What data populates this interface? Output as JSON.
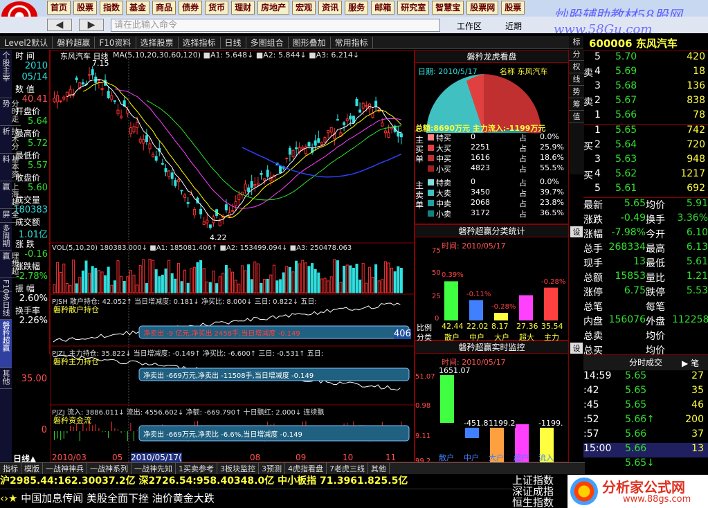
{
  "menu": [
    "首页",
    "股票",
    "指数",
    "基金",
    "商品",
    "债券",
    "货币",
    "理财",
    "房地产",
    "宏观",
    "资讯",
    "服务",
    "邮箱",
    "研究室",
    "智慧宝",
    "股票网",
    "股票"
  ],
  "watermark": "炒股辅助教材58股网",
  "watermark_url": "www.58Gu.com",
  "cmd_placeholder": "请在此输入命令",
  "bar2_right": [
    "工作区",
    "近期",
    "常用指标"
  ],
  "toolbar": [
    "Level2默认",
    "磐矜超赢",
    "F10资料",
    "选择股票",
    "选择指标",
    "日线",
    "多图组合",
    "图形叠加",
    "常用指标"
  ],
  "left_tabs": [
    "个股主宰",
    "分时走势",
    "技术分析",
    "基本资料",
    "上海超赢",
    "全屏",
    "多周期",
    "理想超赢",
    "F10",
    "多日线",
    "磐矜超赢",
    "其他"
  ],
  "info": [
    {
      "label": "时 间",
      "value": "2010",
      "value2": "05/14",
      "c": "cyan"
    },
    {
      "label": "数 值",
      "value": "40.41",
      "c": "red"
    },
    {
      "label": "开盘价",
      "value": "5.64",
      "c": "green"
    },
    {
      "label": "最高价",
      "value": "5.72",
      "c": "green"
    },
    {
      "label": "最低价",
      "value": "5.57",
      "c": "green"
    },
    {
      "label": "收盘价",
      "value": "5.60",
      "c": "green"
    },
    {
      "label": "成交量",
      "value": "180383",
      "c": "cyan"
    },
    {
      "label": "成交额",
      "value": "1.01亿",
      "c": "cyan"
    },
    {
      "label": "涨 跌",
      "value": "-0.16",
      "c": "green"
    },
    {
      "label": "涨跌幅",
      "value": "-2.78%",
      "c": "green"
    },
    {
      "label": "振 幅",
      "value": "2.60%",
      "c": "white"
    },
    {
      "label": "换手率",
      "value": "2.26%",
      "c": "white"
    }
  ],
  "chart_title": "东风汽车 日线",
  "ma_hdr": "MA(5,10,20,30,60,120) ■A1: 5.648↓ ■A2: 5.844↓ ■A3: 6.214↓",
  "high_label": "7.15",
  "low_label": "4.22",
  "vol_hdr": "VOL(5,10,20) 180383.000↓ ■A1: 185081.406↑ ■A2: 153499.094↓ ■A3: 250478.063",
  "pjsh_hdr": "PJSH 散户持仓: 42.052↑ 当日增减度: 0.181↓ 净买比: 8.000↓ 三日: 0.822↓ 五日:",
  "pjsh_name": "磐矜散户持仓",
  "pjsh_val": "406",
  "pjzl_hdr": "PJZL 主力持仓: 35.822↓ 当日增减度: -0.149↑ 净买比: -6.600↑ 三日: -0.531↑ 五日:",
  "pjzl_name": "磐矜主力持仓",
  "pjzl_axis": "35.00",
  "pjzj_hdr": "PJZJ 流入: 3886.011↓ 流出: 4556.602↓ 净额: -669.790↑ 十日飘红: 2.000↓ 连续飘",
  "pjzj_name": "磐矜资金流",
  "pjzj_axis": "0",
  "banner1": "净卖出 -9 亿元,净买出 2458手,当日增减度 -0.149",
  "banner2": "净卖出 -669万元,净卖出 -11508手,当日增减度 -0.149",
  "banner3": "净卖出 -669万元,净卖比 -6.6%,当日增减度 -0.149",
  "timeaxis": [
    "日线▲",
    "2010/03",
    "05",
    "2010/05/17(",
    "08",
    "09",
    "10",
    "11"
  ],
  "dragon": {
    "title": "磐矜龙虎看盘",
    "date": "日期: 2010/5/17",
    "name": "名称 东风汽车",
    "total": "总额:8690万元 主力流入:-1199万元",
    "buy": [
      {
        "n": "特买",
        "v": "0",
        "p": "0.0%"
      },
      {
        "n": "大买",
        "v": "2251",
        "p": "25.9%"
      },
      {
        "n": "中买",
        "v": "1616",
        "p": "18.6%"
      },
      {
        "n": "小买",
        "v": "4823",
        "p": "55.5%"
      }
    ],
    "sell": [
      {
        "n": "特卖",
        "v": "0",
        "p": "0.0%"
      },
      {
        "n": "大卖",
        "v": "3450",
        "p": "39.7%"
      },
      {
        "n": "中卖",
        "v": "2068",
        "p": "23.8%"
      },
      {
        "n": "小卖",
        "v": "3172",
        "p": "36.5%"
      }
    ],
    "zhan": "占",
    "buy_lbl": "主买单",
    "sell_lbl": "主卖单"
  },
  "profit": {
    "title": "磐矜超赢分类统计",
    "time": "时间: 2010/05/17",
    "axis": [
      "75",
      "50",
      "25",
      "0"
    ],
    "ratio_lbl": "比例",
    "class_lbl": "分类",
    "bars": [
      {
        "pct": "0.39%",
        "val": "42.44",
        "cat": "散户"
      },
      {
        "pct": "-0.11%",
        "val": "22.02",
        "cat": "中户"
      },
      {
        "pct": "-0.28%",
        "val": "8.17",
        "cat": "大户"
      },
      {
        "pct": "",
        "val": "27.36",
        "cat": "超大"
      },
      {
        "pct": "-0.28%",
        "val": "35.54",
        "cat": "主力"
      }
    ]
  },
  "monitor": {
    "title": "磐矜超赢实时监控",
    "time": "时间: 2010/05/17",
    "axis": [
      "51.07",
      "0.98",
      "9.11",
      "99.2"
    ],
    "bars": [
      {
        "v": "1651.07",
        "cat": "散户"
      },
      {
        "v": "-451.8",
        "cat": "中户"
      },
      {
        "v": "1199.2",
        "cat": "大户"
      },
      {
        "v": "",
        "cat": "超户"
      },
      {
        "v": "-1199.",
        "cat": "流入"
      }
    ]
  },
  "chart_data": {
    "type": "table",
    "title": "",
    "series": []
  },
  "quote": {
    "code": "600006",
    "name": "东风汽车",
    "sell": [
      {
        "l": "5",
        "p": "5.70",
        "v": "420"
      },
      {
        "l": "4",
        "p": "5.69",
        "v": "18"
      },
      {
        "l": "3",
        "p": "5.68",
        "v": "136"
      },
      {
        "l": "2",
        "p": "5.67",
        "v": "838"
      },
      {
        "l": "1",
        "p": "5.66",
        "v": "78"
      }
    ],
    "buy": [
      {
        "l": "1",
        "p": "5.65",
        "v": "742"
      },
      {
        "l": "2",
        "p": "5.64",
        "v": "720"
      },
      {
        "l": "3",
        "p": "5.63",
        "v": "948"
      },
      {
        "l": "4",
        "p": "5.62",
        "v": "1217"
      },
      {
        "l": "5",
        "p": "5.61",
        "v": "692"
      }
    ],
    "sell_lbl": "卖",
    "buy_lbl": "买",
    "stats": [
      {
        "a": "最新",
        "b": "5.65",
        "c": "均价",
        "d": "5.91"
      },
      {
        "a": "涨跌",
        "b": "-0.49",
        "c": "换手",
        "d": "3.36%"
      },
      {
        "a": "涨幅",
        "b": "-7.98%",
        "c": "今开",
        "d": "6.10"
      },
      {
        "a": "总手",
        "b": "268334",
        "c": "最高",
        "d": "6.13"
      },
      {
        "a": "现手",
        "b": "13",
        "c": "最低",
        "d": "5.61"
      },
      {
        "a": "总额",
        "b": "15853",
        "c": "量比",
        "d": "1.21"
      },
      {
        "a": "涨停",
        "b": "6.75",
        "c": "跌停",
        "d": "5.53"
      },
      {
        "a": "总笔",
        "b": "",
        "c": "每笔",
        "d": ""
      },
      {
        "a": "内盘",
        "b": "156076",
        "c": "外盘",
        "d": "112258"
      },
      {
        "a": "总卖",
        "b": "",
        "c": "均价",
        "d": ""
      },
      {
        "a": "总买",
        "b": "",
        "c": "均价",
        "d": ""
      }
    ]
  },
  "ticks_title": "分时成交",
  "ticks_btn": "笔",
  "ticks": [
    {
      "t": "14:59",
      "p": "5.65",
      "v": "27"
    },
    {
      "t": ":42",
      "p": "5.65",
      "v": "35"
    },
    {
      "t": ":45",
      "p": "5.65",
      "v": "46"
    },
    {
      "t": ":52",
      "p": "5.66↑",
      "v": "200"
    },
    {
      "t": ":57",
      "p": "5.66",
      "v": "37"
    },
    {
      "t": "15:00",
      "p": "5.66",
      "v": "13"
    },
    {
      "t": "",
      "p": "5.65↓",
      "v": ""
    }
  ],
  "side_tabs": [
    "标",
    "分",
    "权",
    "线",
    "势",
    "筹",
    "值"
  ],
  "statusbar": [
    "指标",
    "模版",
    "一战神神兵",
    "一战神系列",
    "一战神先知",
    "1买卖参考",
    "3板块监控",
    "3预测",
    "4虎指看盘",
    "7老虎三线",
    "其他"
  ],
  "idx": "沪2985.44:162.30037.2亿 深2726.54:958.40348.0亿 中小板指 71.3961.825.5亿",
  "news": "中国加息传闻 美股全面下挫 油价黄金大跌",
  "idxlist": [
    "上证指数",
    "深证成指",
    "恒生指数"
  ],
  "brand": "分析家公式网",
  "brand_url": "www.88gs.com"
}
